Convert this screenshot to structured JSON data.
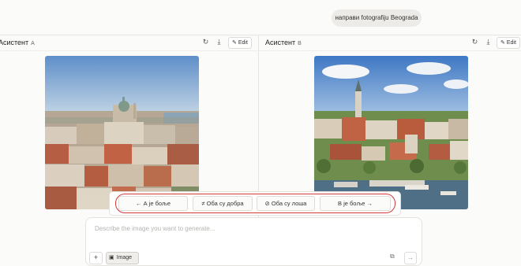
{
  "user_prompt": "направи fotografiju Beograda",
  "assistant_a": {
    "name": "Асистент",
    "tag": "A",
    "edit": "Edit"
  },
  "assistant_b": {
    "name": "Асистент",
    "tag": "B",
    "edit": "Edit"
  },
  "icons": {
    "refresh": "refresh-icon",
    "download": "download-icon",
    "edit": "pencil-icon"
  },
  "vote": {
    "a_better": "← А је боље",
    "both_good": "≠ Оба су добра",
    "both_bad": "⊘ Оба су лоша",
    "b_better": "В је боље →"
  },
  "composer": {
    "placeholder": "Describe the image you want to generate...",
    "plus": "+",
    "image_chip": "Image",
    "send": "→"
  },
  "colors": {
    "highlight_ring": "#d33a3a"
  }
}
